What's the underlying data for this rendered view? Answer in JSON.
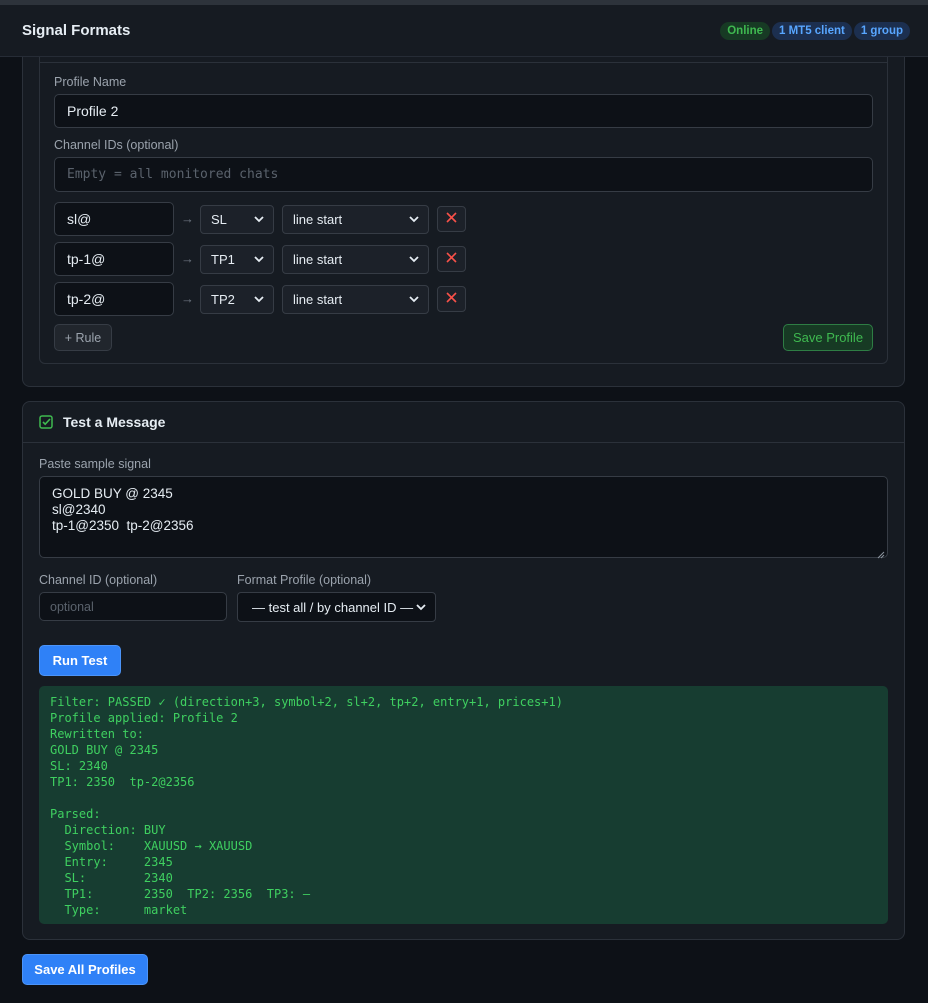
{
  "header": {
    "title": "Signal Formats",
    "badges": {
      "online": "Online",
      "clients": "1 MT5 client",
      "groups": "1 group"
    }
  },
  "profile": {
    "name_label": "Profile Name",
    "name_value": "Profile 2",
    "channels_label": "Channel IDs (optional)",
    "channels_placeholder": "Empty = all monitored chats",
    "rule_arrow": "→",
    "rules": [
      {
        "pattern": "sl@",
        "field": "SL",
        "mode": "line start"
      },
      {
        "pattern": "tp-1@",
        "field": "TP1",
        "mode": "line start"
      },
      {
        "pattern": "tp-2@",
        "field": "TP2",
        "mode": "line start"
      }
    ],
    "add_rule_label": "+ Rule",
    "save_profile_label": "Save Profile"
  },
  "test": {
    "title": "Test a Message",
    "sample_label": "Paste sample signal",
    "sample_lines": [
      "GOLD BUY @ 2345",
      "sl@2340",
      "tp-1@2350  tp-2@2356"
    ],
    "channel_label": "Channel ID (optional)",
    "channel_placeholder": "optional",
    "profile_label": "Format Profile (optional)",
    "profile_selected": "— test all / by channel ID —",
    "run_label": "Run Test",
    "output_lines": [
      "Filter: PASSED ✓ (direction+3, symbol+2, sl+2, tp+2, entry+1, prices+1)",
      "Profile applied: Profile 2",
      "Rewritten to:",
      "GOLD BUY @ 2345",
      "SL: 2340",
      "TP1: 2350  tp-2@2356",
      "",
      "Parsed:",
      "  Direction: BUY",
      "  Symbol:    XAUUSD → XAUUSD",
      "  Entry:     2345",
      "  SL:        2340",
      "  TP1:       2350  TP2: 2356  TP3: —",
      "  Type:      market"
    ]
  },
  "footer": {
    "save_all_label": "Save All Profiles"
  },
  "colors": {
    "accent_blue": "#2f81f7",
    "success_green": "#3fb950",
    "danger_red": "#f85149"
  }
}
